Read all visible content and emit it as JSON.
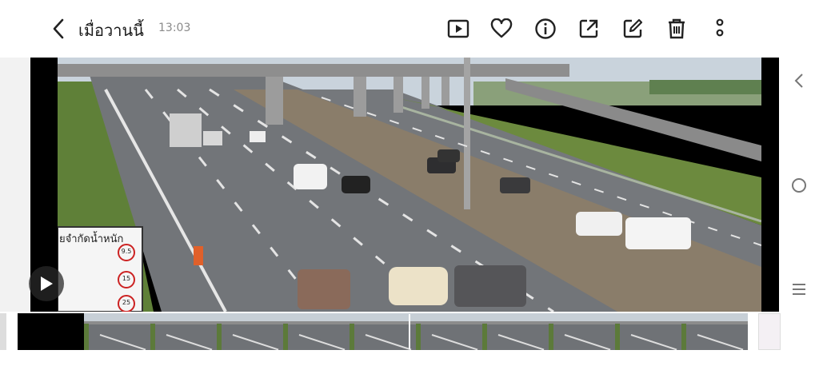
{
  "header": {
    "title": "เมื่อวานนี้",
    "time": "13:03"
  },
  "toolbar": {
    "icons": [
      "back-icon",
      "play-video-icon",
      "heart-icon",
      "info-icon",
      "share-icon",
      "edit-icon",
      "trash-icon",
      "more-icon"
    ]
  },
  "video": {
    "sign_text": "ยจำกัดน้ำหนัก",
    "sign_values": [
      "9.5",
      "15",
      "25"
    ]
  },
  "nav": {
    "icons": [
      "recent-apps-icon",
      "home-icon",
      "back-nav-icon"
    ]
  },
  "filmstrip": {
    "frame_count": 11
  },
  "colors": {
    "sky": "#c7d1da",
    "road": "#6e7174",
    "grass": "#5a7a36",
    "icon": "#222222"
  }
}
